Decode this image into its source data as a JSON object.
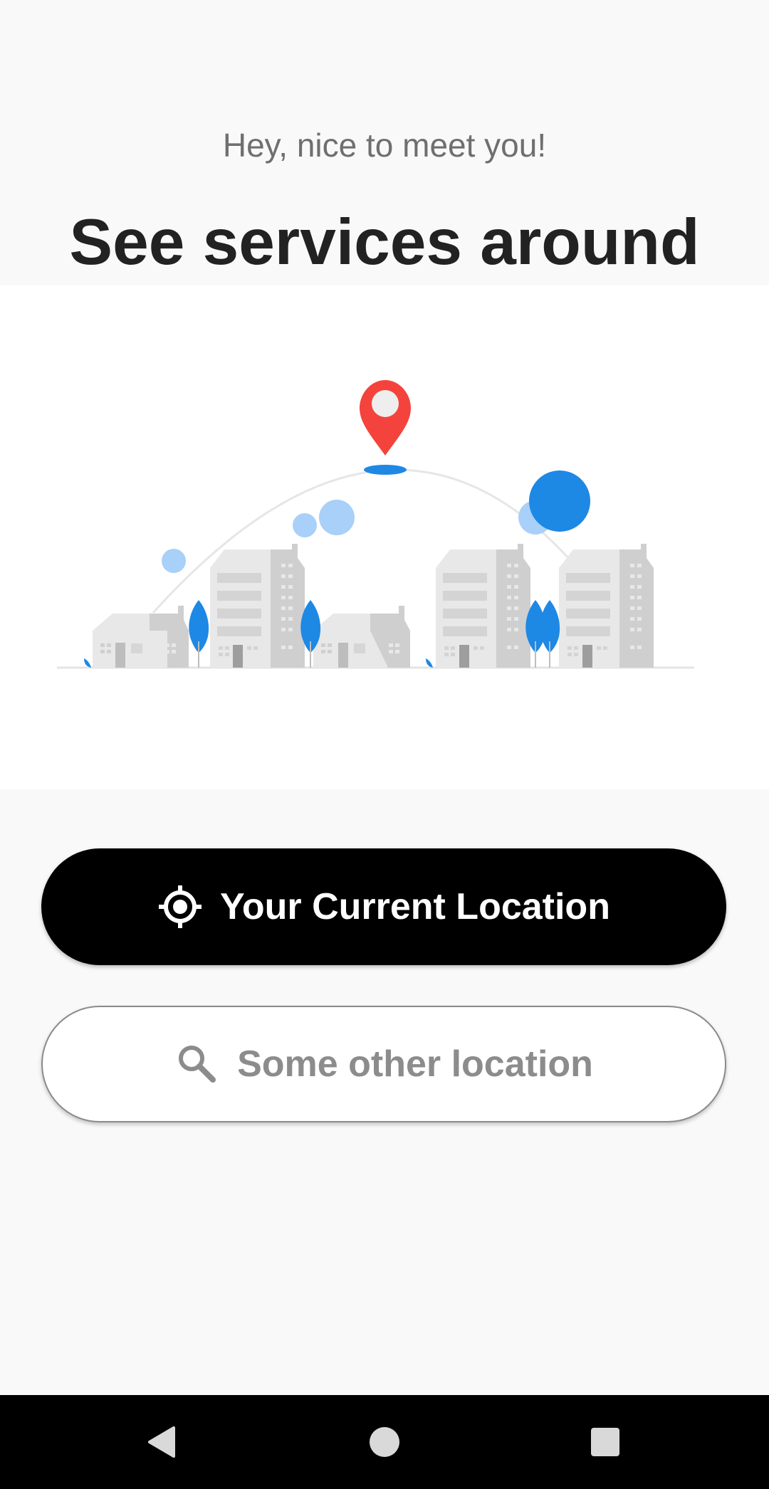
{
  "onboarding": {
    "greeting": "Hey, nice to meet you!",
    "headline": "See services around"
  },
  "illustration": {
    "icon": "city-location-illustration",
    "colors": {
      "pin": "#f4433c",
      "accent_blue": "#1e88e5",
      "light_blue": "#a8d0f8",
      "building_light": "#e8e8e8",
      "building_dark": "#cfcfcf"
    }
  },
  "actions": {
    "current_location": {
      "label": "Your Current Location",
      "icon": "my-location-icon"
    },
    "other_location": {
      "label": "Some other location",
      "icon": "search-icon"
    }
  },
  "system_nav": {
    "back_icon": "back-icon",
    "home_icon": "home-icon",
    "recents_icon": "recents-icon"
  },
  "theme": {
    "background": "#f9f9f9",
    "primary_button": "#000000",
    "secondary_button_border": "#8a8a8a"
  }
}
